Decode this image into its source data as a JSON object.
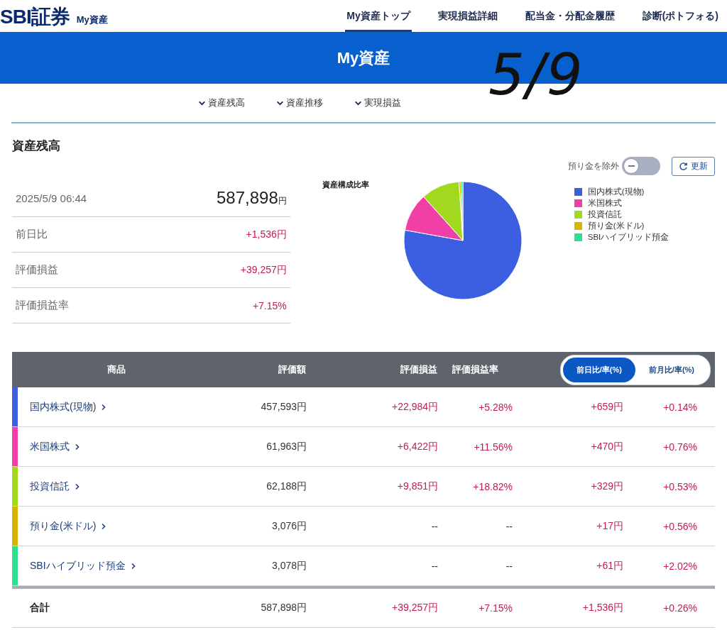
{
  "header": {
    "logo": "SBI証券",
    "logo_sub": "My資産",
    "nav": [
      {
        "label": "My資産トップ",
        "selected": true
      },
      {
        "label": "実現損益詳細",
        "selected": false
      },
      {
        "label": "配当金・分配金履歴",
        "selected": false
      },
      {
        "label": "診断(ポトフォる)",
        "selected": false
      }
    ]
  },
  "banner": {
    "title": "My資産"
  },
  "annotation": {
    "text": "5/9"
  },
  "anchors": [
    "資産残高",
    "資産推移",
    "実現損益"
  ],
  "balance": {
    "title": "資産残高",
    "timestamp": "2025/5/9 06:44",
    "total": "587,898",
    "total_unit": "円",
    "rows": [
      {
        "label": "前日比",
        "value": "+1,536円"
      },
      {
        "label": "評価損益",
        "value": "+39,257円"
      },
      {
        "label": "評価損益率",
        "value": "+7.15%"
      }
    ]
  },
  "toggle": {
    "label": "預り金を除外",
    "on": false
  },
  "refresh_button": "更新",
  "composition": {
    "title": "資産構成比率",
    "legend": [
      {
        "label": "国内株式(現物)",
        "color": "#3b5fe0"
      },
      {
        "label": "米国株式",
        "color": "#f040a8"
      },
      {
        "label": "投資信託",
        "color": "#a2d820"
      },
      {
        "label": "預り金(米ドル)",
        "color": "#d8b400"
      },
      {
        "label": "SBIハイブリッド預金",
        "color": "#2ee08e"
      }
    ]
  },
  "table": {
    "columns": [
      "商品",
      "評価額",
      "評価損益",
      "評価損益率"
    ],
    "segments": [
      {
        "label": "前日比/率(%)",
        "selected": true
      },
      {
        "label": "前月比/率(%)",
        "selected": false
      }
    ],
    "rows": [
      {
        "name": "国内株式(現物)",
        "color": "#3b5fe0",
        "value": "457,593円",
        "gain": "+22,984円",
        "gain_rate": "+5.28%",
        "change": "+659円",
        "change_rate": "+0.14%"
      },
      {
        "name": "米国株式",
        "color": "#f040a8",
        "value": "61,963円",
        "gain": "+6,422円",
        "gain_rate": "+11.56%",
        "change": "+470円",
        "change_rate": "+0.76%"
      },
      {
        "name": "投資信託",
        "color": "#a2d820",
        "value": "62,188円",
        "gain": "+9,851円",
        "gain_rate": "+18.82%",
        "change": "+329円",
        "change_rate": "+0.53%"
      },
      {
        "name": "預り金(米ドル)",
        "color": "#d8b400",
        "value": "3,076円",
        "gain": "--",
        "gain_rate": "--",
        "change": "+17円",
        "change_rate": "+0.56%"
      },
      {
        "name": "SBIハイブリッド預金",
        "color": "#2ee08e",
        "value": "3,078円",
        "gain": "--",
        "gain_rate": "--",
        "change": "+61円",
        "change_rate": "+2.02%"
      }
    ],
    "total": {
      "name": "合計",
      "value": "587,898円",
      "gain": "+39,257円",
      "gain_rate": "+7.15%",
      "change": "+1,536円",
      "change_rate": "+0.26%"
    }
  }
}
